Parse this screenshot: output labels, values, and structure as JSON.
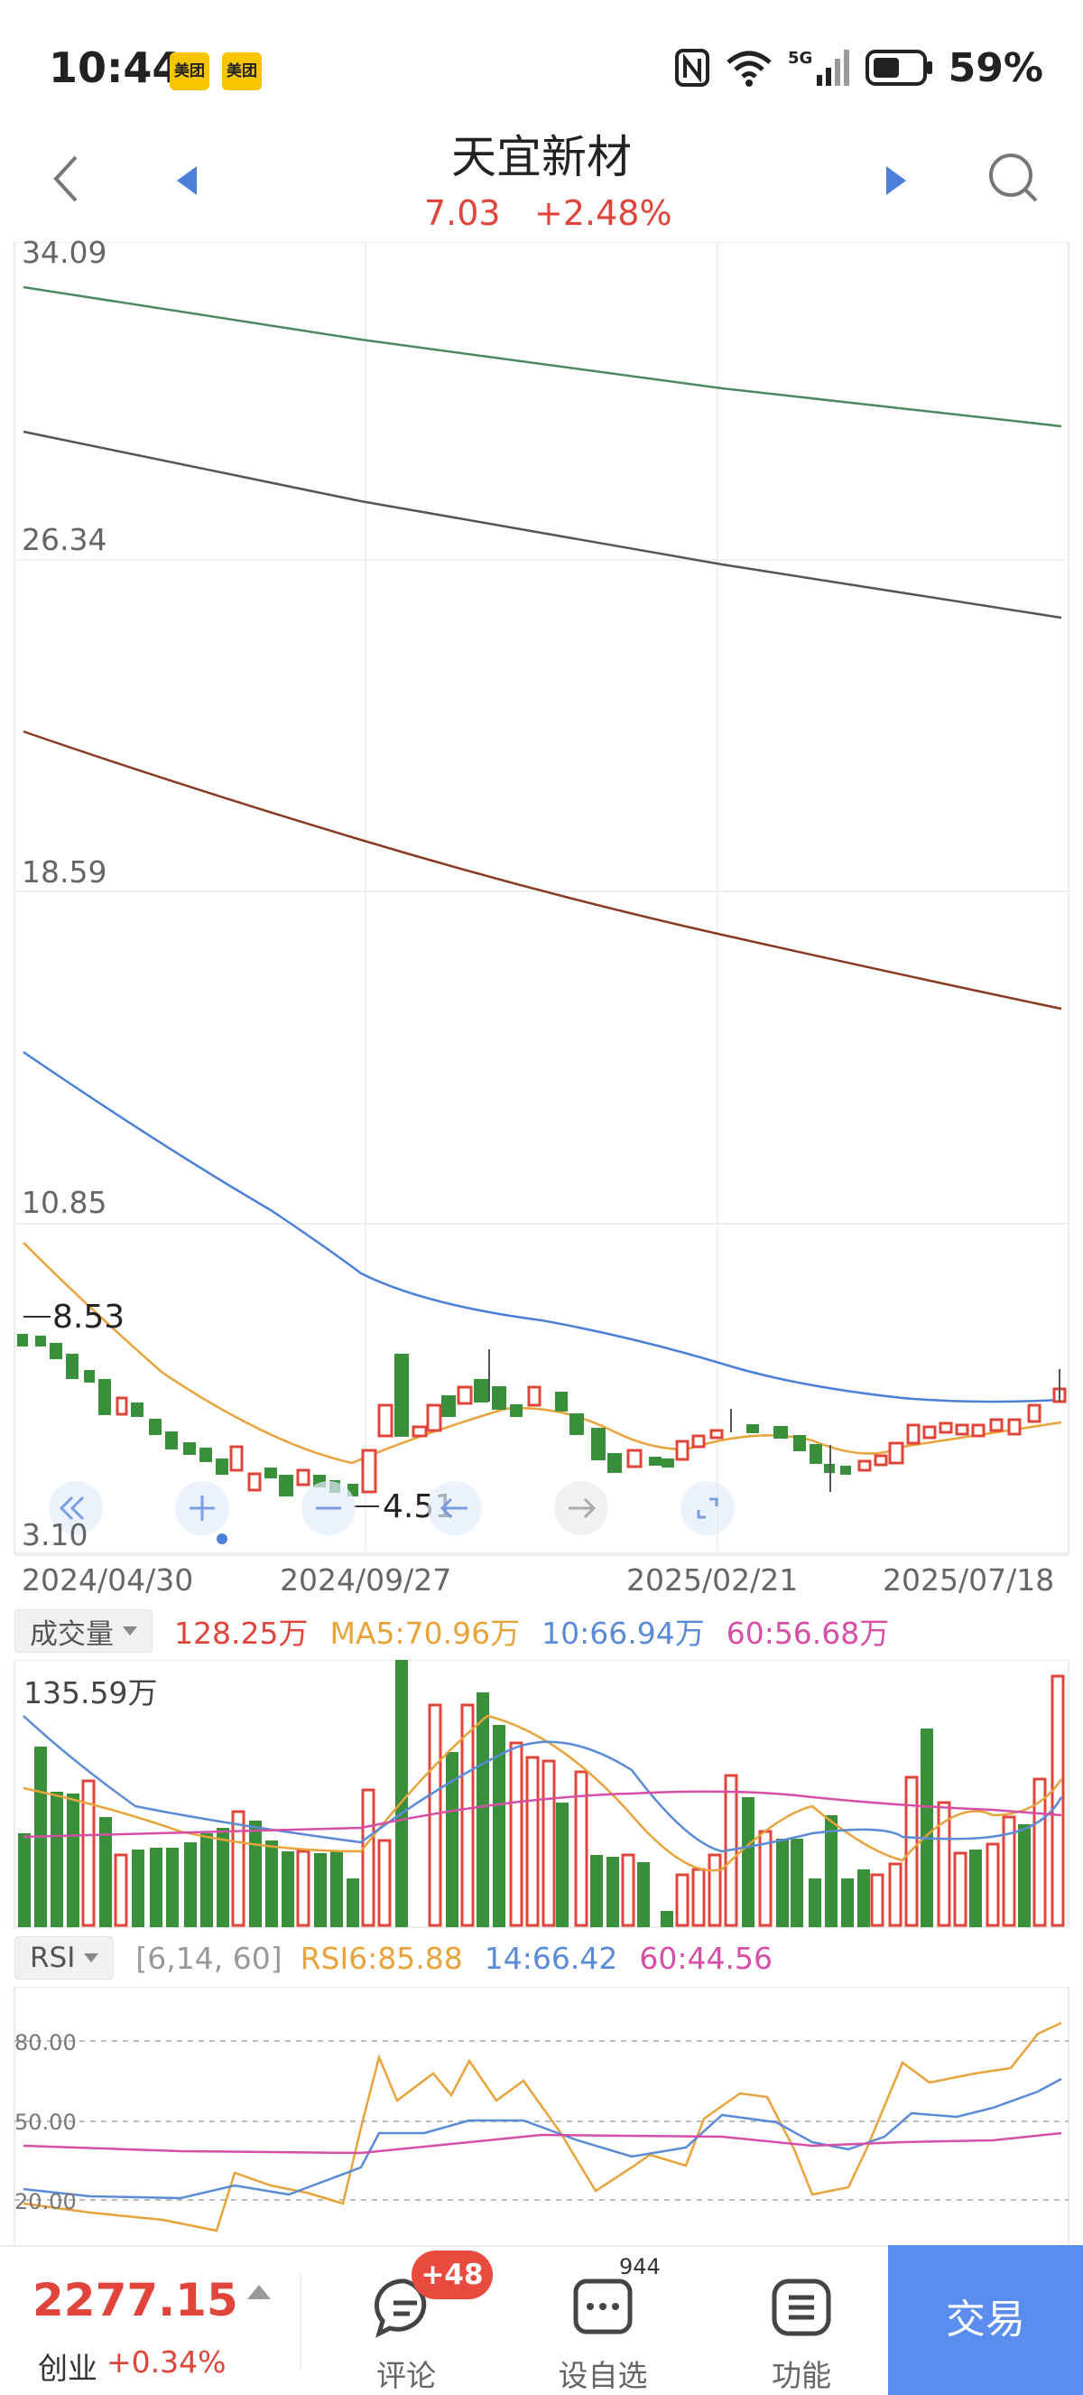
{
  "status_bar": {
    "time": "10:44",
    "app_badges": [
      "美团",
      "美团"
    ],
    "network": "5G",
    "battery": "59%"
  },
  "header": {
    "stock_name": "天宜新材",
    "price": "7.03",
    "change_pct": "+2.48%"
  },
  "main_chart": {
    "y_labels": [
      "34.09",
      "26.34",
      "18.59",
      "10.85",
      "3.10"
    ],
    "x_labels": [
      "2024/04/30",
      "2024/09/27",
      "2025/02/21",
      "2025/07/18"
    ],
    "high_marker": "8.53",
    "low_marker": "4.51"
  },
  "volume": {
    "selector_label": "成交量",
    "current": "128.25万",
    "ma5": "MA5:70.96万",
    "ma10": "10:66.94万",
    "ma60": "60:56.68万",
    "max_label": "135.59万"
  },
  "rsi": {
    "selector_label": "RSI",
    "params": "[6,14, 60]",
    "rsi6": "RSI6:85.88",
    "rsi14": "14:66.42",
    "rsi60": "60:44.56",
    "levels": [
      "80.00",
      "50.00",
      "20.00"
    ]
  },
  "bottom_bar": {
    "index_value": "2277.15",
    "index_name": "创业",
    "index_change": "+0.34%",
    "comments_label": "评论",
    "comments_badge": "+48",
    "watchlist_label": "设自选",
    "watchlist_count": "944",
    "functions_label": "功能",
    "trade_label": "交易"
  },
  "colors": {
    "up": "#e0443b",
    "down": "#3a8f3a",
    "ma5": "#e8a33a",
    "ma10": "#5b8bd6",
    "ma60": "#d64ea6",
    "accent": "#5b8def"
  }
}
